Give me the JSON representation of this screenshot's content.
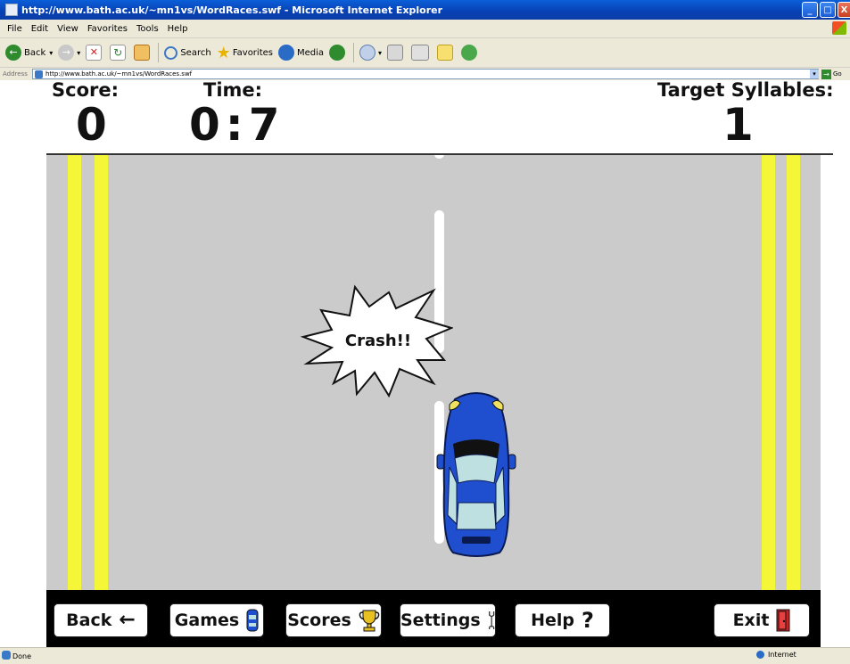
{
  "window": {
    "title": "http://www.bath.ac.uk/~mn1vs/WordRaces.swf - Microsoft Internet Explorer",
    "controls": {
      "minimize": "_",
      "maximize": "□",
      "close": "X"
    }
  },
  "menu": [
    "File",
    "Edit",
    "View",
    "Favorites",
    "Tools",
    "Help"
  ],
  "toolbar": {
    "back_label": "Back",
    "search_label": "Search",
    "favorites_label": "Favorites",
    "media_label": "Media"
  },
  "address": {
    "label": "Address",
    "url": "http://www.bath.ac.uk/~mn1vs/WordRaces.swf",
    "go_label": "Go"
  },
  "game": {
    "score_label": "Score:",
    "score_value": "0",
    "time_label": "Time:",
    "time_value": "0:7",
    "target_label": "Target Syllables:",
    "target_value": "1",
    "crash_text": "Crash!!",
    "buttons": {
      "back": "Back",
      "games": "Games",
      "scores": "Scores",
      "settings": "Settings",
      "help": "Help",
      "exit": "Exit"
    },
    "colors": {
      "road": "#cbcbcb",
      "stripe": "#f6f638",
      "car": "#1f4fcf",
      "bar": "#000000"
    }
  },
  "status": {
    "text": "Done",
    "zone": "Internet"
  }
}
